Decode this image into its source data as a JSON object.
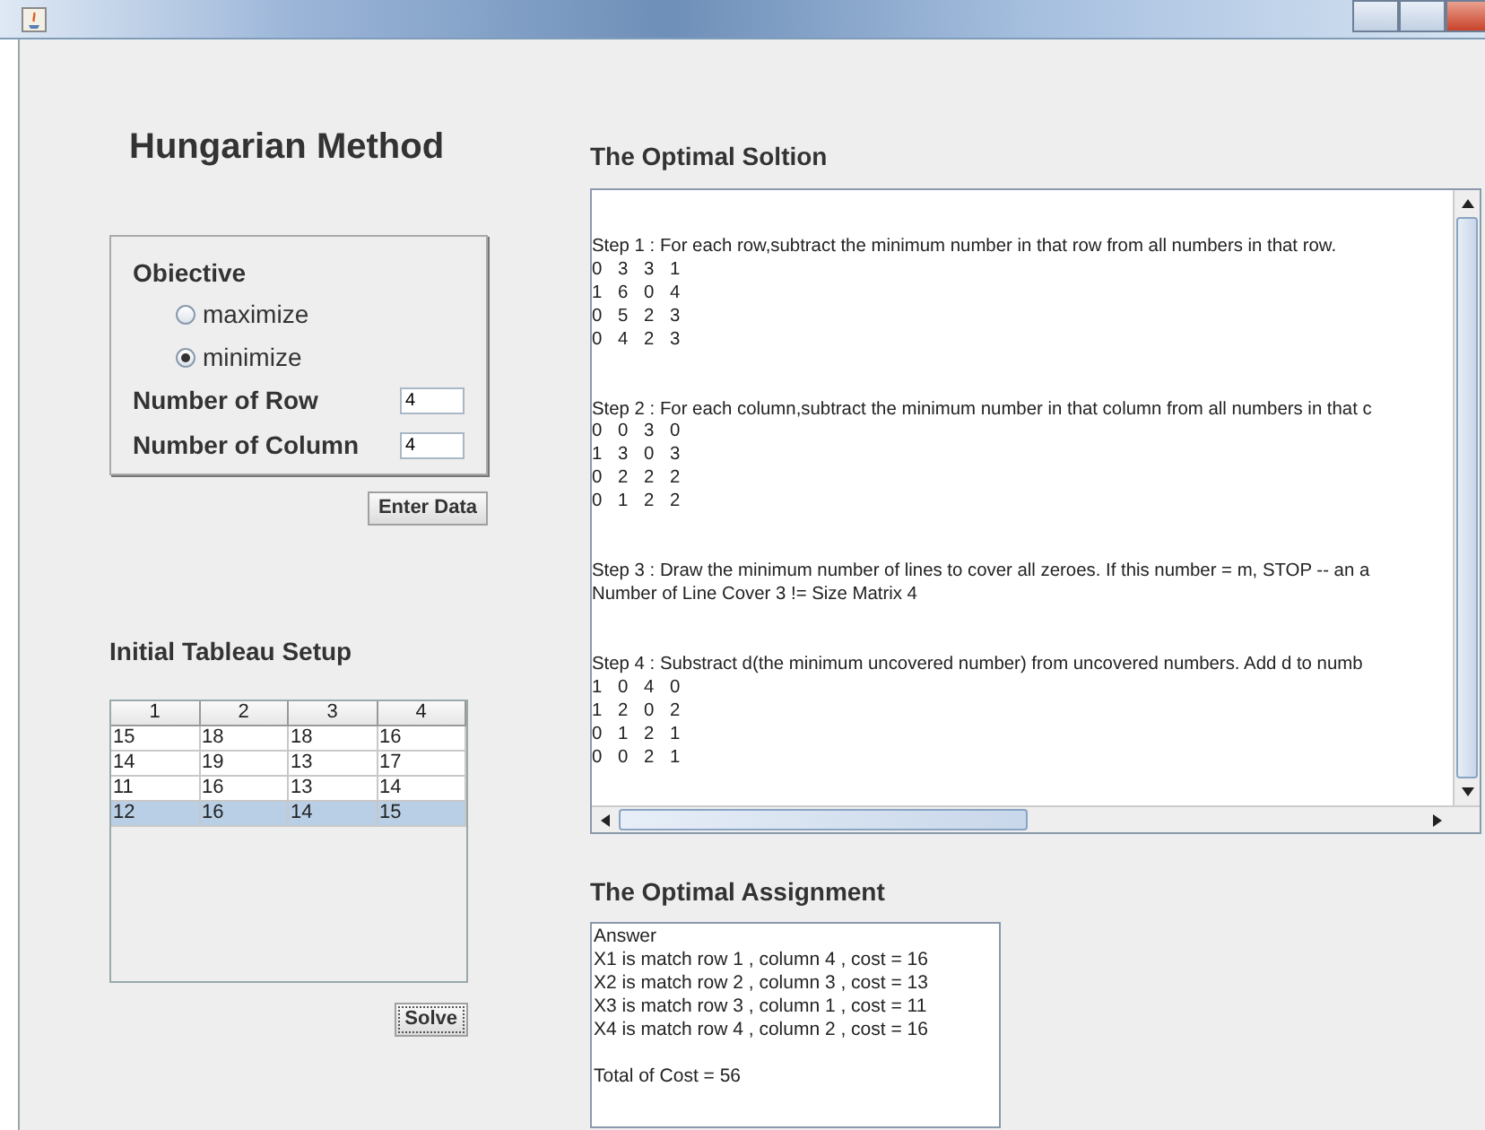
{
  "title": "Hungarian Method",
  "objective": {
    "label": "Obiective",
    "options": [
      {
        "label": "maximize",
        "selected": false
      },
      {
        "label": "minimize",
        "selected": true
      }
    ]
  },
  "fields": [
    {
      "label": "Number of Row",
      "value": "4"
    },
    {
      "label": "Number of Column",
      "value": "4"
    }
  ],
  "enter_button": "Enter Data",
  "tableau": {
    "title": "Initial Tableau Setup",
    "columns": [
      "1",
      "2",
      "3",
      "4"
    ],
    "rows": [
      {
        "cells": [
          "15",
          "18",
          "18",
          "16"
        ],
        "selected": false
      },
      {
        "cells": [
          "14",
          "19",
          "13",
          "17"
        ],
        "selected": false
      },
      {
        "cells": [
          "11",
          "16",
          "13",
          "14"
        ],
        "selected": false
      },
      {
        "cells": [
          "12",
          "16",
          "14",
          "15"
        ],
        "selected": true
      }
    ]
  },
  "solve_button": "Solve",
  "solution": {
    "title": "The Optimal Soltion",
    "steps": [
      {
        "lines": [
          "Step 1 : For each row,subtract the minimum number in that row from all numbers in that row."
        ],
        "matrix": [
          "0 3 3 1",
          "1 6 0 4",
          "0 5 2 3",
          "0 4 2 3"
        ]
      },
      {
        "lines": [
          "Step 2 : For each column,subtract the minimum number in that column from all numbers in that c"
        ],
        "matrix": [
          "0 0 3 0",
          "1 3 0 3",
          "0 2 2 2",
          "0 1 2 2"
        ]
      },
      {
        "lines": [
          "Step 3 : Draw the minimum number of lines to cover all zeroes. If this number = m, STOP -- an a",
          "Number of Line Cover 3 != Size Matrix 4"
        ]
      },
      {
        "lines": [
          "Step 4 : Substract d(the minimum uncovered number) from uncovered numbers. Add d to numb"
        ],
        "matrix": [
          "1 0 4 0",
          "1 2 0 2",
          "0 1 2 1",
          "0 0 2 1"
        ]
      }
    ]
  },
  "assignment": {
    "title": "The Optimal Assignment",
    "lines": [
      "Answer",
      "X1 is match row 1 , column 4 , cost = 16",
      "X2 is match row 2 , column 3 , cost = 13",
      "X3 is match row 3 , column 1 , cost = 11",
      "X4 is match row 4 , column 2 , cost = 16"
    ],
    "total": "Total of Cost = 56"
  }
}
